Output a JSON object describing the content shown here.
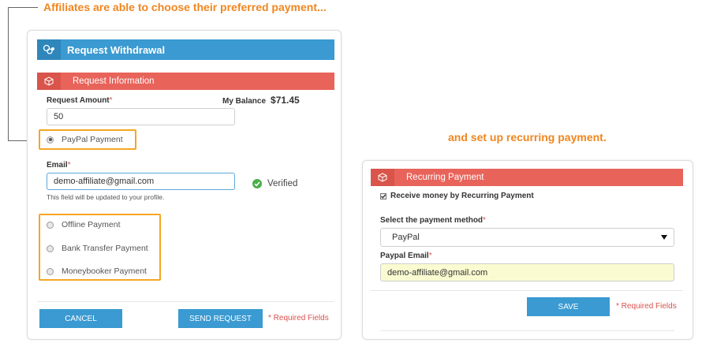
{
  "captions": {
    "left": "Affiliates are able to choose their preferred payment...",
    "right": "and set up recurring payment."
  },
  "request_card": {
    "title": "Request Withdrawal",
    "section_title": "Request Information",
    "amount_label": "Request Amount",
    "required_mark": "*",
    "balance_label": "My Balance",
    "balance_value": "$71.45",
    "amount_value": "50",
    "selected_method": "PayPal Payment",
    "email_label": "Email",
    "email_value": "demo-affiliate@gmail.com",
    "verified_label": "Verified",
    "email_hint": "This field will be updated to your profile.",
    "other_methods": [
      "Offline Payment",
      "Bank Transfer Payment",
      "Moneybooker Payment"
    ],
    "cancel_label": "CANCEL",
    "send_label": "SEND REQUEST",
    "required_note": "* Required Fields"
  },
  "recurring_card": {
    "section_title": "Recurring Payment",
    "checkbox_label": "Receive money by Recurring Payment",
    "checkbox_checked": true,
    "method_label": "Select the payment method",
    "method_value": "PayPal",
    "paypal_email_label": "Paypal Email",
    "paypal_email_value": "demo-affiliate@gmail.com",
    "save_label": "SAVE",
    "required_note": "* Required Fields"
  },
  "colors": {
    "caption": "#f0861f",
    "blue_header": "#3a9ad1",
    "red_header": "#e8635a",
    "highlight_box": "#f5a623",
    "verified": "#4cae4c",
    "autofill_bg": "#fafbd0"
  },
  "icons": {
    "request_header": "coins-icon",
    "section_header": "cube-icon",
    "verified": "check-circle-icon",
    "select_arrow": "caret-down-icon"
  }
}
